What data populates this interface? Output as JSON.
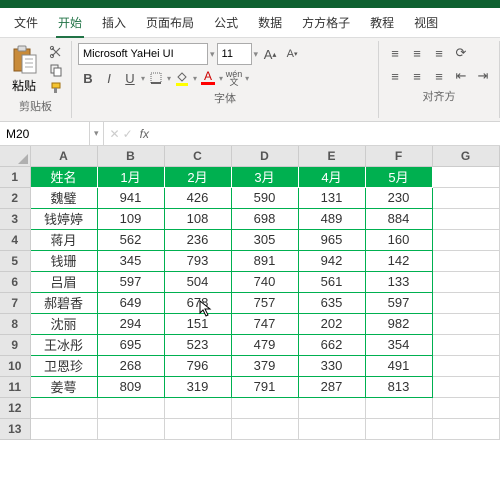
{
  "tabs": [
    "文件",
    "开始",
    "插入",
    "页面布局",
    "公式",
    "数据",
    "方方格子",
    "教程",
    "视图"
  ],
  "active_tab_index": 1,
  "ribbon": {
    "paste_label": "粘贴",
    "clipboard_group": "剪贴板",
    "font_name": "Microsoft YaHei UI",
    "font_size": "11",
    "font_group": "字体",
    "align_group": "对齐方",
    "bold": "B",
    "italic": "I",
    "underline": "U",
    "wen": "wén"
  },
  "namebox": "M20",
  "fx": "fx",
  "grid": {
    "col_labels": [
      "A",
      "B",
      "C",
      "D",
      "E",
      "F",
      "G"
    ],
    "row_labels": [
      "1",
      "2",
      "3",
      "4",
      "5",
      "6",
      "7",
      "8",
      "9",
      "10",
      "11",
      "12",
      "13"
    ],
    "headers": [
      "姓名",
      "1月",
      "2月",
      "3月",
      "4月",
      "5月"
    ],
    "rows": [
      [
        "魏璧",
        "941",
        "426",
        "590",
        "131",
        "230"
      ],
      [
        "钱婷婷",
        "109",
        "108",
        "698",
        "489",
        "884"
      ],
      [
        "蒋月",
        "562",
        "236",
        "305",
        "965",
        "160"
      ],
      [
        "钱珊",
        "345",
        "793",
        "891",
        "942",
        "142"
      ],
      [
        "吕眉",
        "597",
        "504",
        "740",
        "561",
        "133"
      ],
      [
        "郝碧香",
        "649",
        "678",
        "757",
        "635",
        "597"
      ],
      [
        "沈丽",
        "294",
        "151",
        "747",
        "202",
        "982"
      ],
      [
        "王冰彤",
        "695",
        "523",
        "479",
        "662",
        "354"
      ],
      [
        "卫恩珍",
        "268",
        "796",
        "379",
        "330",
        "491"
      ],
      [
        "姜萼",
        "809",
        "319",
        "791",
        "287",
        "813"
      ]
    ]
  },
  "cursor_cell": {
    "row": 6,
    "col": 2
  }
}
